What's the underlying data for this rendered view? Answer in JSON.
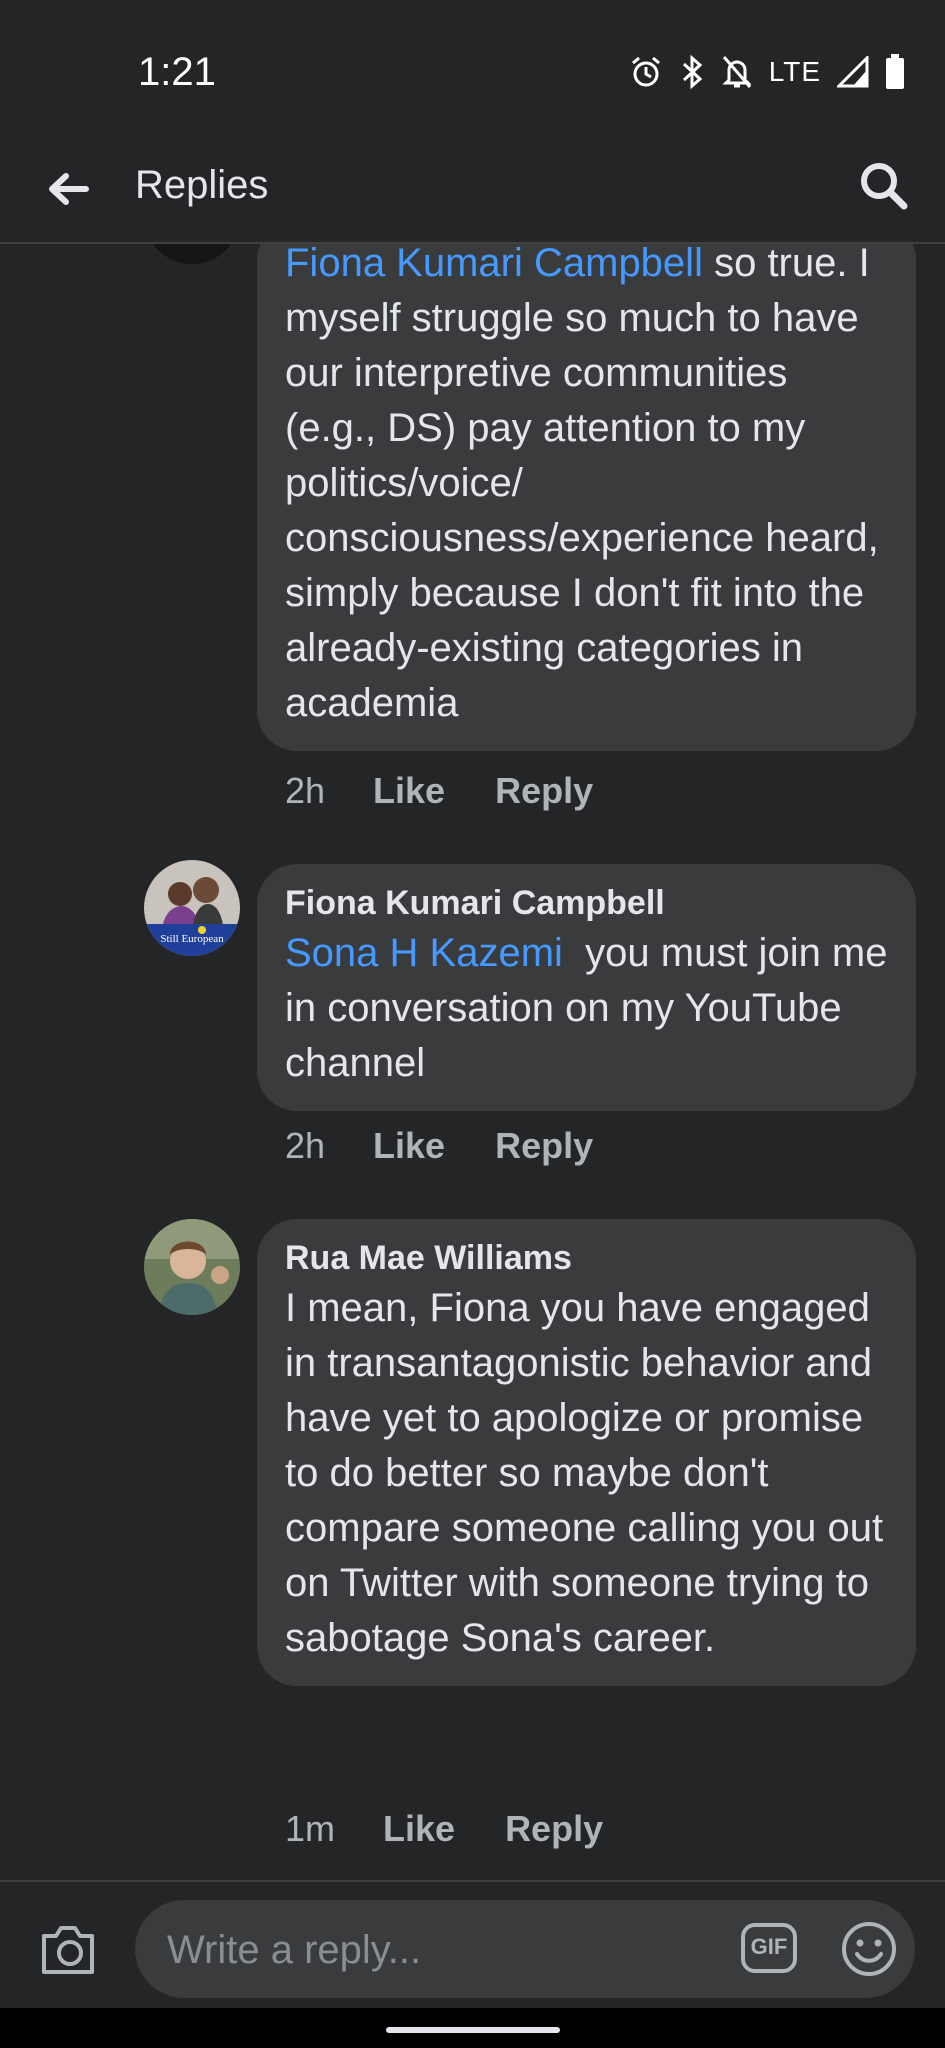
{
  "status_bar": {
    "time": "1:21",
    "network": "LTE",
    "icons": [
      "alarm-icon",
      "bluetooth-icon",
      "notifications-off-icon",
      "signal-icon",
      "battery-icon"
    ]
  },
  "header": {
    "title": "Replies",
    "back_icon": "arrow-left-icon",
    "search_icon": "search-icon"
  },
  "comments": [
    {
      "author": "",
      "mention": "Fiona Kumari Campbell",
      "text": "so true. I myself struggle so much to have our interpretive communities (e.g., DS) pay attention to my politics/voice/ consciousness/experience heard, simply because I don't fit into the already-existing categories in academia",
      "time": "2h",
      "like_label": "Like",
      "reply_label": "Reply"
    },
    {
      "author": "Fiona Kumari Campbell",
      "mention": "Sona H Kazemi",
      "text": "you must join me in conversation on my YouTube channel",
      "avatar_text": "Still European",
      "time": "2h",
      "like_label": "Like",
      "reply_label": "Reply"
    },
    {
      "author": "Rua Mae Williams",
      "text": "I mean, Fiona you have engaged in transantagonistic behavior and have yet to apologize or promise to do better so maybe don't compare someone calling you out on Twitter with someone trying to sabotage Sona's career.",
      "time": "1m",
      "like_label": "Like",
      "reply_label": "Reply"
    }
  ],
  "composer": {
    "placeholder": "Write a reply...",
    "gif_label": "GIF",
    "camera_icon": "camera-icon",
    "emoji_icon": "emoji-icon"
  },
  "colors": {
    "background": "#242526",
    "bubble": "#3a3b3c",
    "mention": "#4599ff",
    "secondary_text": "#b0b3b8"
  }
}
